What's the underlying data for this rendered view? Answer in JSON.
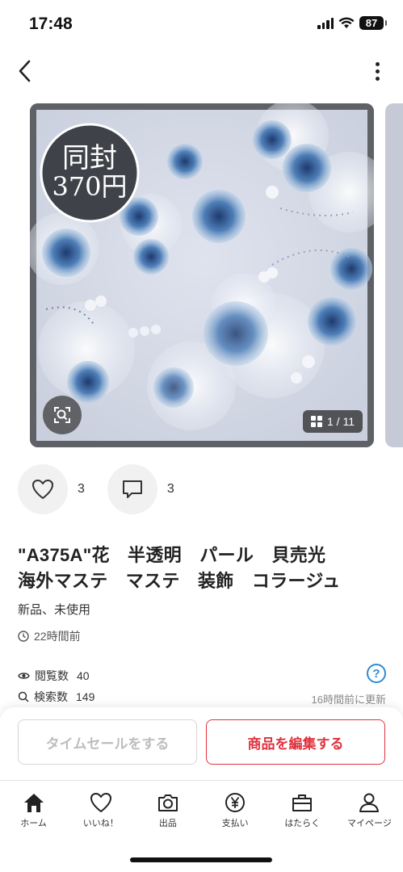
{
  "status_bar": {
    "time": "17:48",
    "battery": "87"
  },
  "nav": {
    "back": "back",
    "more": "more"
  },
  "carousel": {
    "overlay_line1": "同封",
    "overlay_line2": "370円",
    "counter": "1 / 11"
  },
  "reactions": {
    "likes": "3",
    "comments": "3"
  },
  "item": {
    "title_line1": "\"A375A\"花　半透明　パール　貝売光",
    "title_line2": "海外マステ　マステ　装飾　コラージュ",
    "condition": "新品、未使用",
    "posted": "22時間前"
  },
  "stats": {
    "views_label": "閲覧数",
    "views": "40",
    "search_label": "検索数",
    "search": "149",
    "help": "?",
    "updated": "16時間前に更新"
  },
  "actions": {
    "timesale": "タイムセールをする",
    "edit": "商品を編集する"
  },
  "tabs": [
    {
      "label": "ホーム",
      "icon": "home-icon"
    },
    {
      "label": "いいね！",
      "icon": "heart-icon"
    },
    {
      "label": "出品",
      "icon": "camera-icon"
    },
    {
      "label": "支払い",
      "icon": "yen-icon"
    },
    {
      "label": "はたらく",
      "icon": "briefcase-icon"
    },
    {
      "label": "マイページ",
      "icon": "person-icon"
    }
  ],
  "colors": {
    "accent_red": "#e0313d",
    "help_blue": "#2e8ad8"
  }
}
